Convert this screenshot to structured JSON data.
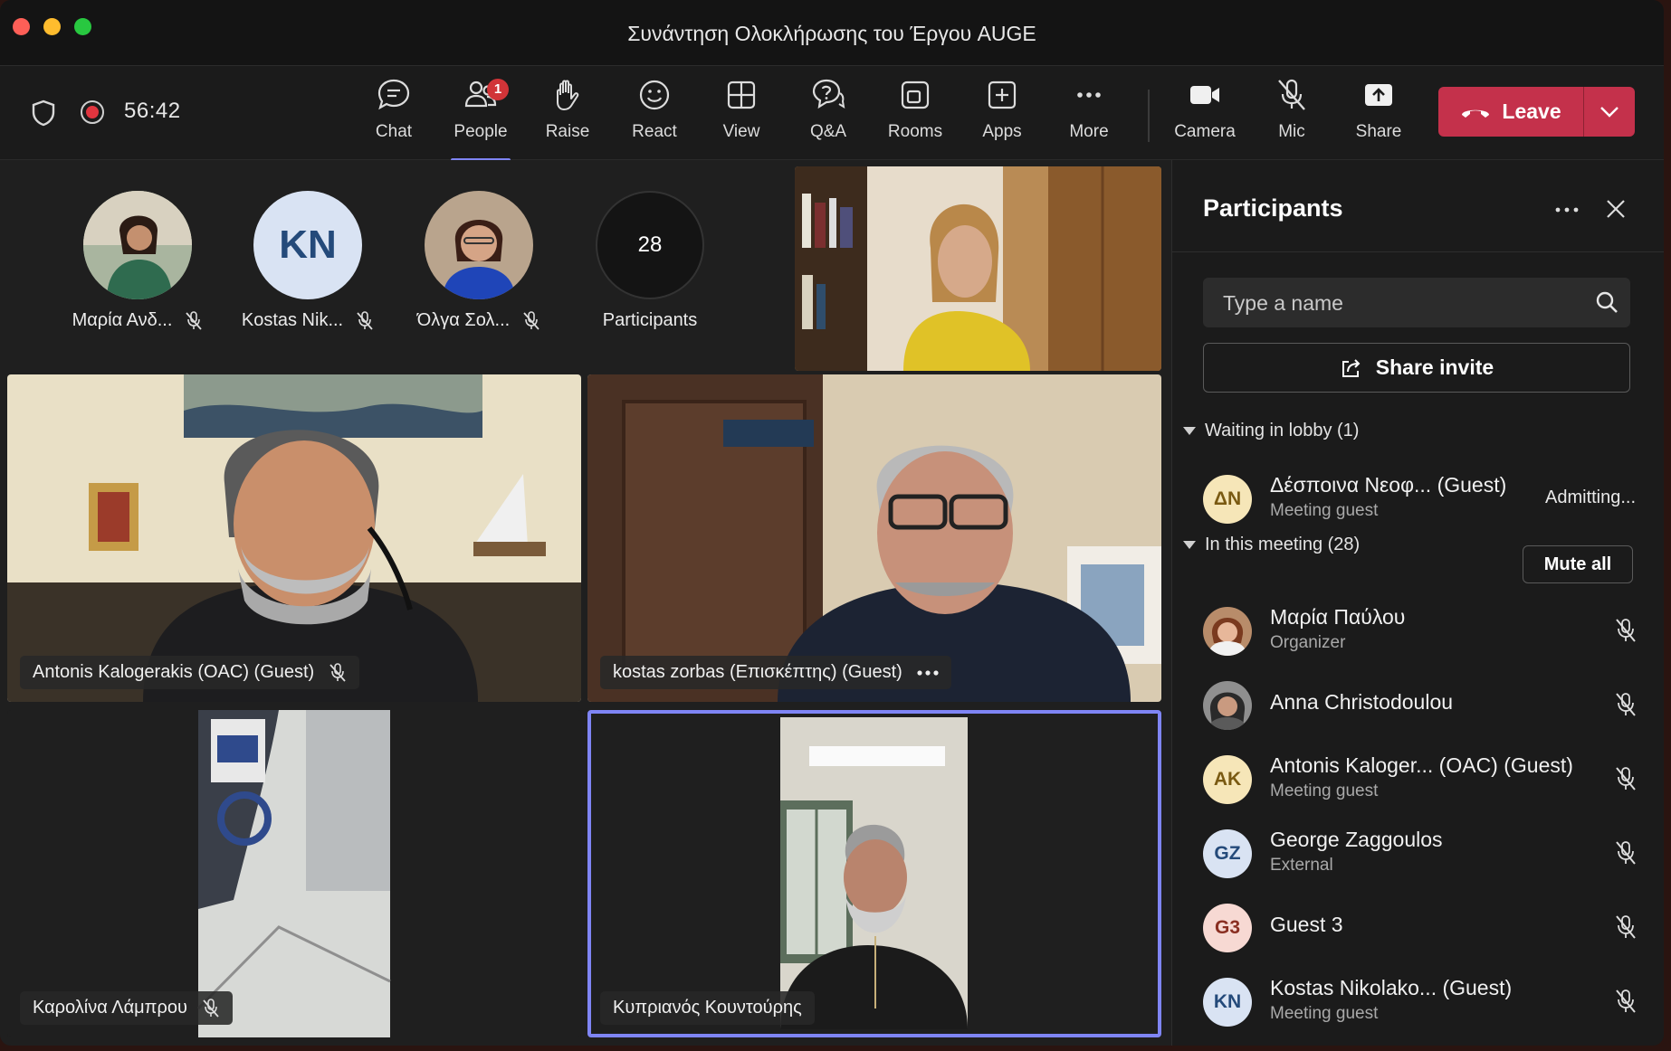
{
  "window": {
    "title": "Συνάντηση Ολοκλήρωσης του Έργου AUGE"
  },
  "toolbar": {
    "timer": "56:42",
    "buttons": [
      {
        "label": "Chat",
        "icon": "chat-icon"
      },
      {
        "label": "People",
        "icon": "people-icon",
        "badge": "1",
        "active": true
      },
      {
        "label": "Raise",
        "icon": "raise-hand-icon"
      },
      {
        "label": "React",
        "icon": "smiley-icon"
      },
      {
        "label": "View",
        "icon": "grid-view-icon"
      },
      {
        "label": "Q&A",
        "icon": "qa-icon"
      },
      {
        "label": "Rooms",
        "icon": "rooms-icon"
      },
      {
        "label": "Apps",
        "icon": "apps-plus-icon"
      },
      {
        "label": "More",
        "icon": "more-dots-icon"
      },
      {
        "label": "Camera",
        "icon": "camera-icon"
      },
      {
        "label": "Mic",
        "icon": "mic-off-icon"
      },
      {
        "label": "Share",
        "icon": "share-tray-icon"
      }
    ],
    "leave_label": "Leave"
  },
  "stage": {
    "avatars": [
      {
        "name": "Μαρία Ανδ...",
        "muted": true
      },
      {
        "name": "Kostas Nik...",
        "initials": "KN",
        "muted": true
      },
      {
        "name": "Όλγα Σολ...",
        "muted": true
      }
    ],
    "overflow": {
      "count": "28",
      "label": "Participants"
    },
    "tiles": [
      {
        "name": "Antonis Kalogerakis (OAC) (Guest)",
        "muted": true
      },
      {
        "name": "kostas zorbas (Επισκέπτης) (Guest)",
        "more": true
      },
      {
        "name": "Καρολίνα Λάμπρου",
        "muted": true
      },
      {
        "name": "Κυπριανός Κουντούρης",
        "selected": true
      }
    ]
  },
  "panel": {
    "title": "Participants",
    "search_placeholder": "Type a name",
    "share_invite": "Share invite",
    "lobby_header": "Waiting in lobby (1)",
    "lobby": [
      {
        "initials": "ΔΝ",
        "name": "Δέσποινα Νεοφ... (Guest)",
        "sub": "Meeting guest",
        "status": "Admitting..."
      }
    ],
    "meeting_header": "In this meeting (28)",
    "mute_all": "Mute all",
    "participants": [
      {
        "name": "Μαρία Παύλου",
        "sub": "Organizer",
        "photo": true
      },
      {
        "name": "Anna Christodoulou",
        "sub": "",
        "photo": true
      },
      {
        "initials": "AK",
        "name": "Antonis Kaloger... (OAC) (Guest)",
        "sub": "Meeting guest"
      },
      {
        "initials": "GZ",
        "name": "George Zaggoulos",
        "sub": "External"
      },
      {
        "initials": "G3",
        "name": "Guest 3",
        "sub": ""
      },
      {
        "initials": "KN",
        "name": "Kostas Nikolako... (Guest)",
        "sub": "Meeting guest"
      }
    ]
  },
  "colors": {
    "accent": "#7f85f5",
    "leave": "#c4314b",
    "badge": "#d13438",
    "window_bg": "#1f1f1f"
  }
}
